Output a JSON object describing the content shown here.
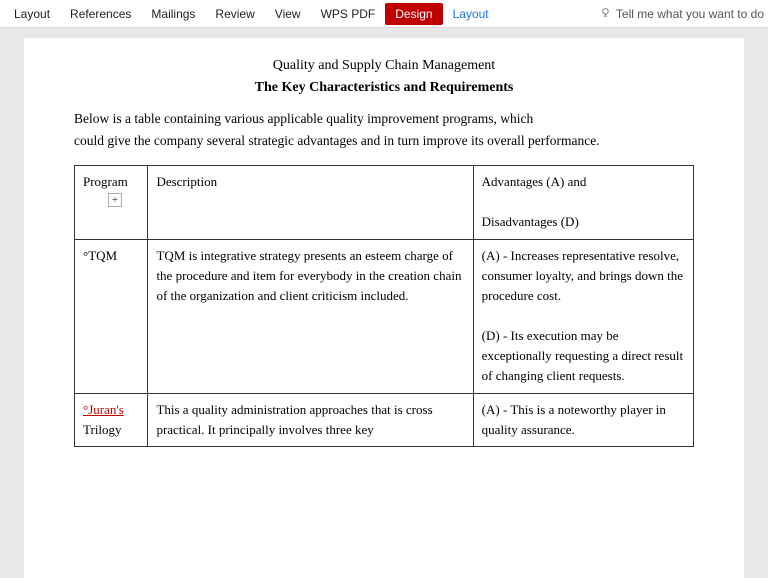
{
  "menubar": {
    "items": [
      {
        "label": "Layout",
        "state": "normal"
      },
      {
        "label": "References",
        "state": "normal"
      },
      {
        "label": "Mailings",
        "state": "normal"
      },
      {
        "label": "Review",
        "state": "normal"
      },
      {
        "label": "View",
        "state": "normal"
      },
      {
        "label": "WPS PDF",
        "state": "normal"
      },
      {
        "label": "Design",
        "state": "active-design"
      },
      {
        "label": "Layout",
        "state": "active-layout"
      }
    ],
    "search_placeholder": "Tell me what you want to do"
  },
  "document": {
    "title": "Quality and Supply Chain Management",
    "subtitle": "The Key Characteristics and Requirements",
    "intro_line1": "Below is a table containing various applicable quality improvement programs, which",
    "intro_line2": "could give the company several strategic advantages and in turn improve its overall performance."
  },
  "table": {
    "headers": {
      "program": "Program",
      "description": "Description",
      "advantages": "Advantages (A) and",
      "disadvantages": "Disadvantages (D)"
    },
    "rows": [
      {
        "program": "°TQM",
        "program_underline": false,
        "description": "TQM is integrative strategy presents an esteem charge of the procedure and item for everybody in the creation chain of the organization and client criticism included.",
        "advantages_A": "(A) - Increases representative resolve, consumer loyalty, and brings down the procedure cost.",
        "advantages_D": "(D) - Its execution may be exceptionally requesting a direct result of changing client requests."
      },
      {
        "program": "°Juran's\nTrilogy",
        "program_underline": true,
        "description": "This a quality administration approaches that is cross practical. It principally involves three key",
        "advantages_A": "(A) - This is a noteworthy player in quality assurance."
      }
    ]
  }
}
